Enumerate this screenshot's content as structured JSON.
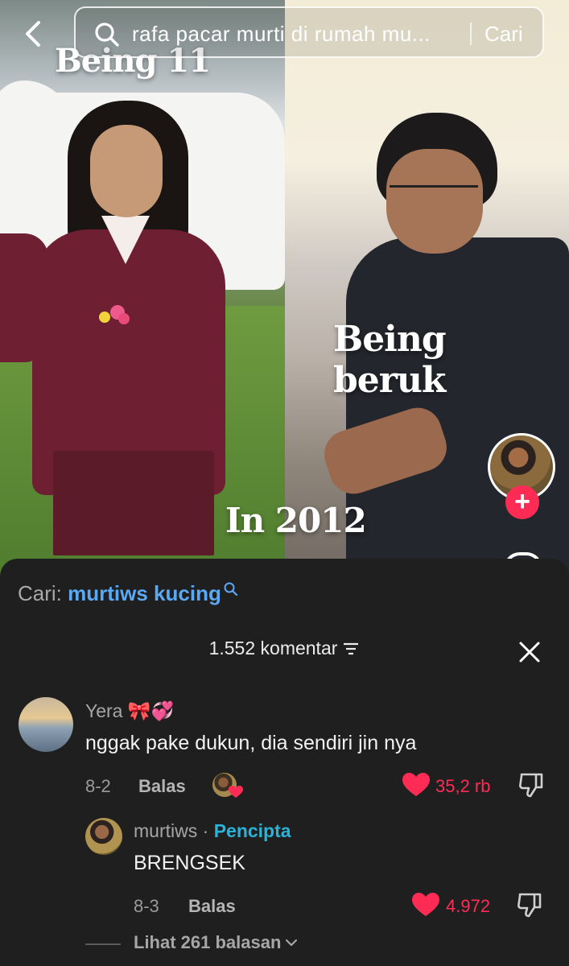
{
  "search": {
    "query": "rafa pacar murti di rumah mu...",
    "submit_label": "Cari"
  },
  "video": {
    "caption_top": "Being 11",
    "caption_middle": "Being beruk",
    "caption_bottom": "In 2012"
  },
  "comments_sheet": {
    "suggest_label": "Cari:",
    "suggest_query": "murtiws kucing",
    "count_label": "1.552 komentar",
    "comments": [
      {
        "name": "Yera 🎀💞",
        "text": "nggak pake dukun, dia sendiri jin nya",
        "date": "8-2",
        "reply_label": "Balas",
        "likes": "35,2 rb"
      },
      {
        "name": "murtiws",
        "separator": "·",
        "badge": "Pencipta",
        "text": "BRENGSEK",
        "date": "8-3",
        "reply_label": "Balas",
        "likes": "4.972"
      }
    ],
    "view_replies_label": "Lihat 261 balasan"
  },
  "colors": {
    "accent_red": "#fe2c55",
    "link_blue": "#5aa9f5",
    "creator_tag": "#2ab3d7",
    "sheet_bg": "#1f1f1f"
  },
  "icons": [
    "back-icon",
    "search-icon",
    "filter-icon",
    "close-icon",
    "heart-icon",
    "dislike-icon",
    "chevron-down-icon",
    "plus-icon"
  ]
}
